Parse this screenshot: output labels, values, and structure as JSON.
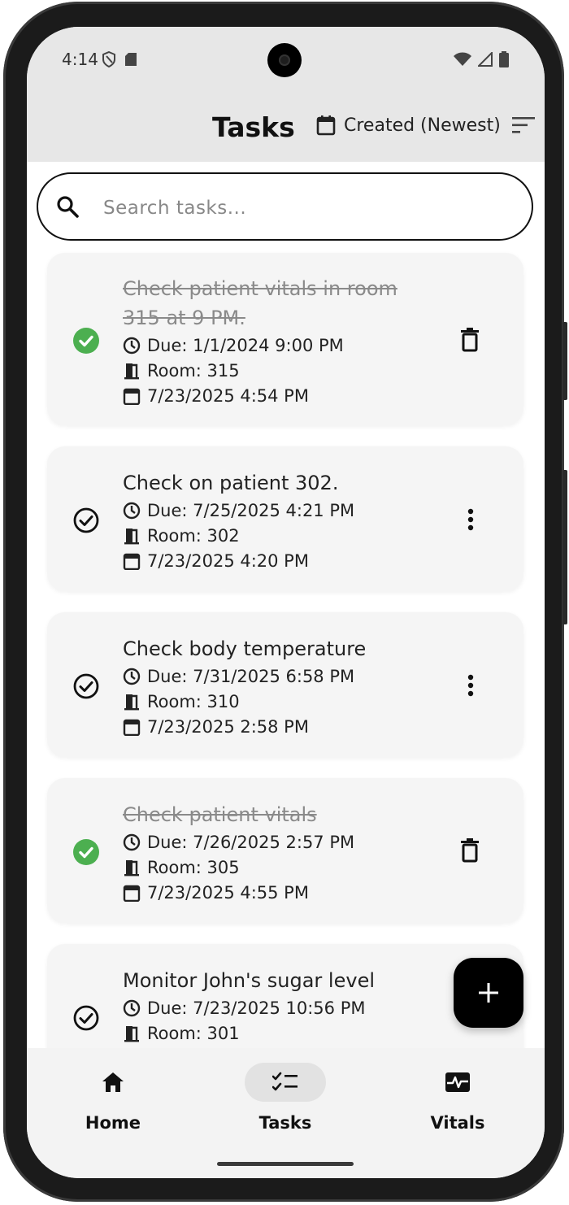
{
  "status": {
    "time": "4:14"
  },
  "header": {
    "title": "Tasks",
    "sort_label": "Created (Newest)"
  },
  "search": {
    "placeholder": "Search tasks..."
  },
  "tasks": [
    {
      "title": "Check patient vitals in room 315 at 9 PM.",
      "completed": true,
      "due": "Due: 1/1/2024 9:00 PM",
      "room": "Room: 315",
      "created": "7/23/2025 4:54 PM",
      "action_icon": "trash-icon"
    },
    {
      "title": "Check on patient 302.",
      "completed": false,
      "due": "Due: 7/25/2025 4:21 PM",
      "room": "Room: 302",
      "created": "7/23/2025 4:20 PM",
      "action_icon": "more-vert-icon"
    },
    {
      "title": "Check body temperature",
      "completed": false,
      "due": "Due: 7/31/2025 6:58 PM",
      "room": "Room: 310",
      "created": "7/23/2025 2:58 PM",
      "action_icon": "more-vert-icon"
    },
    {
      "title": "Check patient vitals",
      "completed": true,
      "due": "Due: 7/26/2025 2:57 PM",
      "room": "Room: 305",
      "created": "7/23/2025 4:55 PM",
      "action_icon": "trash-icon"
    },
    {
      "title": "Monitor John's sugar level",
      "completed": false,
      "due": "Due: 7/23/2025 10:56 PM",
      "room": "Room: 301",
      "action_icon": "more-vert-icon"
    }
  ],
  "fab": {
    "icon": "plus-icon"
  },
  "nav": [
    {
      "label": "Home",
      "icon": "home-icon",
      "active": false
    },
    {
      "label": "Tasks",
      "icon": "tasks-checklist-icon",
      "active": true
    },
    {
      "label": "Vitals",
      "icon": "vitals-monitor-icon",
      "active": false
    }
  ],
  "colors": {
    "done_check": "#4caf50",
    "fab_bg": "#000000",
    "header_bg": "#e7e7e7",
    "card_bg": "#f5f5f5"
  }
}
